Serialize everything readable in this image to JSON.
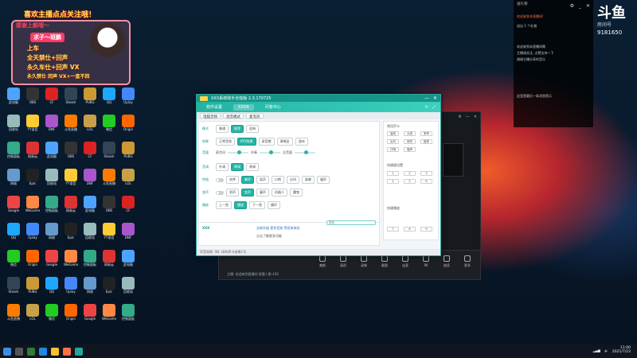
{
  "overlay": {
    "title": "喜欢主播点点关注哦！",
    "header": "感谢上舰哦～",
    "badge": "求子～班鹏",
    "lines": [
      "上车",
      "全天禁仕+回声",
      "永久车仕+回声  VX",
      "永久禁仕 回声 VX+一直不回"
    ]
  },
  "desktop_icons": [
    {
      "label": "此电脑",
      "color": "#4da3ff"
    },
    {
      "label": "回收站",
      "color": "#9bb"
    },
    {
      "label": "控制面板",
      "color": "#3a8"
    },
    {
      "label": "网络",
      "color": "#69c"
    },
    {
      "label": "Google",
      "color": "#e44"
    },
    {
      "label": "QQ",
      "color": "#1ea7ff"
    },
    {
      "label": "微信",
      "color": "#2c2"
    },
    {
      "label": "Steam",
      "color": "#345"
    },
    {
      "label": "斗鱼直播",
      "color": "#ff7b00"
    },
    {
      "label": "OBS",
      "color": "#333"
    },
    {
      "label": "YY语音",
      "color": "#fc3"
    },
    {
      "label": "网易云",
      "color": "#d33"
    },
    {
      "label": "Epic",
      "color": "#222"
    },
    {
      "label": "WeGame",
      "color": "#f84"
    },
    {
      "label": "Uplay",
      "color": "#48f"
    },
    {
      "label": "Origin",
      "color": "#f60"
    },
    {
      "label": "PUBG",
      "color": "#c93"
    },
    {
      "label": "LOL",
      "color": "#c8a048"
    },
    {
      "label": "CF",
      "color": "#d22"
    },
    {
      "label": "DNF",
      "color": "#a5c"
    }
  ],
  "chat": {
    "name": "送礼物",
    "controls": [
      "⚙",
      "_",
      "✕"
    ],
    "messages": [
      {
        "text": "欢迎来到本直播间!",
        "hl": "欢迎"
      },
      {
        "text": "送出 1 个礼物",
        "hl": ""
      },
      {
        "text": "欢迎来到本直播间哦",
        "hl": ""
      },
      {
        "text": "主播请关注, 点赞支持一下",
        "hl": ""
      },
      {
        "text": "谢谢主播分享的音乐",
        "hl": ""
      },
      {
        "text": "这里是最后一条消息提示",
        "hl": ""
      }
    ]
  },
  "brand": {
    "big": "斗鱼",
    "small": "房间号",
    "num": "9181650"
  },
  "app": {
    "title": "XXX系统助手全能版  2.3.170725",
    "nav_tabs": [
      "软件设置",
      "XXXA",
      "问答中心"
    ],
    "subtabs": [
      "电脑音频",
      "混音模式",
      "麦克风"
    ],
    "rows": [
      {
        "label": "模式",
        "buttons": [
          "普通",
          "推荐",
          "混响"
        ]
      },
      {
        "label": "效果",
        "buttons": [
          "正常音效",
          "KTV效果",
          "录音棚",
          "演唱会",
          "混响"
        ]
      },
      {
        "label": "音量",
        "buttons": [
          "麦克风",
          "伴奏",
          "总音量"
        ]
      },
      {
        "label": "音调",
        "buttons": [
          "升调",
          "降调",
          "原调"
        ]
      },
      {
        "label": "特效",
        "buttons": [
          "欢呼",
          "掌声",
          "笑声",
          "口哨",
          "尖叫",
          "鼓掌",
          "嘘声"
        ]
      },
      {
        "label": "变声",
        "buttons": [
          "男声",
          "女声",
          "童声",
          "机器人",
          "魔鬼"
        ]
      },
      {
        "label": "播放",
        "buttons": [
          "上一首",
          "播放",
          "下一首",
          "循环"
        ]
      }
    ],
    "right_header_1": "常用声卡",
    "right_header_2": "快捷键设置",
    "right_header_3": "快捷播放",
    "right_cells": [
      "高亮",
      "大笑",
      "掌声",
      "尖叫",
      "欢呼",
      "鼓掌",
      "口哨",
      "嘘声",
      "1",
      "2",
      "3",
      "4",
      "5",
      "6",
      "7",
      "8",
      "9"
    ],
    "ad_title": "XXX",
    "ad_text_1": "全新升级 更多音效 等您来体验",
    "ad_text_2": "点击了解更多功能",
    "search_placeholder": "搜索",
    "status": "声音效果: SN. LB的声卡效果1号"
  },
  "dock": {
    "items": [
      "美颜",
      "画质",
      "录制",
      "截图",
      "连麦",
      "PK",
      "抽奖",
      "更多"
    ],
    "tip": "主播: 欢迎来到直播间 观看人数 456"
  },
  "clock": {
    "time": "11:00",
    "date": "2021/7/23"
  }
}
